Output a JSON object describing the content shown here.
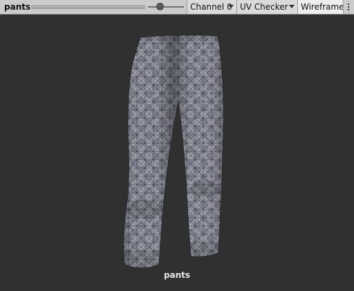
{
  "toolbar": {
    "title": "pants",
    "channel_label": "Channel 0",
    "texture_label": "UV Checker",
    "wireframe_label": "Wireframe",
    "wireframe_active": true
  },
  "viewport": {
    "mesh_name": "pants",
    "background": "#303030",
    "mesh_color": "#8e919c",
    "wire_color": "#2f3138"
  }
}
